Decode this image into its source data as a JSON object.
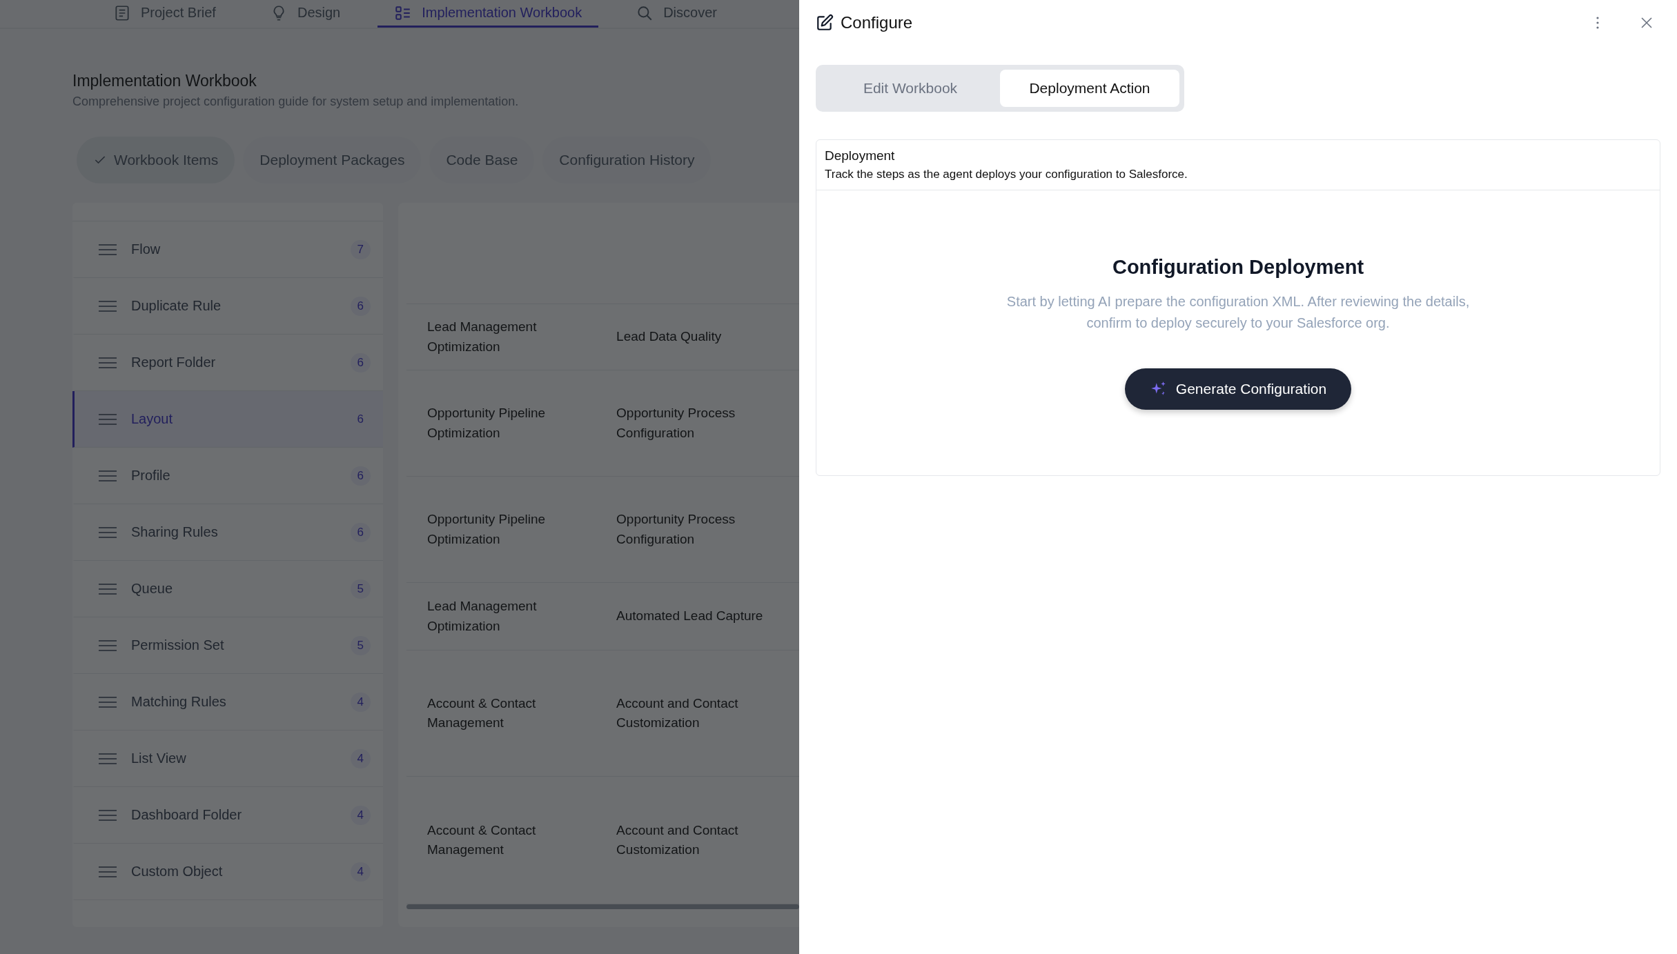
{
  "nav_tabs": [
    {
      "label": "Project Brief",
      "selected": false
    },
    {
      "label": "Design",
      "selected": false
    },
    {
      "label": "Implementation Workbook",
      "selected": true
    },
    {
      "label": "Discover",
      "selected": false
    }
  ],
  "page": {
    "title": "Implementation Workbook",
    "subtitle": "Comprehensive project configuration guide for system setup and implementation."
  },
  "filter_chips": [
    {
      "label": "Workbook Items",
      "selected": true
    },
    {
      "label": "Deployment Packages",
      "selected": false
    },
    {
      "label": "Code Base",
      "selected": false
    },
    {
      "label": "Configuration History",
      "selected": false
    }
  ],
  "sidebar": {
    "items": [
      {
        "label": "Flow",
        "count": "7",
        "selected": false
      },
      {
        "label": "Duplicate Rule",
        "count": "6",
        "selected": false
      },
      {
        "label": "Report Folder",
        "count": "6",
        "selected": false
      },
      {
        "label": "Layout",
        "count": "6",
        "selected": true
      },
      {
        "label": "Profile",
        "count": "6",
        "selected": false
      },
      {
        "label": "Sharing Rules",
        "count": "6",
        "selected": false
      },
      {
        "label": "Queue",
        "count": "5",
        "selected": false
      },
      {
        "label": "Permission Set",
        "count": "5",
        "selected": false
      },
      {
        "label": "Matching Rules",
        "count": "4",
        "selected": false
      },
      {
        "label": "List View",
        "count": "4",
        "selected": false
      },
      {
        "label": "Dashboard Folder",
        "count": "4",
        "selected": false
      },
      {
        "label": "Custom Object",
        "count": "4",
        "selected": false
      }
    ]
  },
  "table": {
    "rows": [
      {
        "column_1": "Lead Management Optimization",
        "column_2": "Lead Data Quality"
      },
      {
        "column_1": "Opportunity Pipeline Optimization",
        "column_2": "Opportunity Process Configuration"
      },
      {
        "column_1": "Opportunity Pipeline Optimization",
        "column_2": "Opportunity Process Configuration"
      },
      {
        "column_1": "Lead Management Optimization",
        "column_2": "Automated Lead Capture"
      },
      {
        "column_1": "Account & Contact Management",
        "column_2": "Account and Contact Customization"
      },
      {
        "column_1": "Account & Contact Management",
        "column_2": "Account and Contact Customization"
      }
    ]
  },
  "panel": {
    "title": "Configure",
    "tabs": [
      {
        "label": "Edit Workbook",
        "selected": false
      },
      {
        "label": "Deployment Action",
        "selected": true
      }
    ],
    "card": {
      "title": "Deployment",
      "description": "Track the steps as the agent deploys your configuration to Salesforce.",
      "heading": "Configuration Deployment",
      "text": "Start by letting AI prepare the configuration XML. After reviewing the details, confirm to deploy securely to your Salesforce org.",
      "button": "Generate Configuration"
    }
  }
}
